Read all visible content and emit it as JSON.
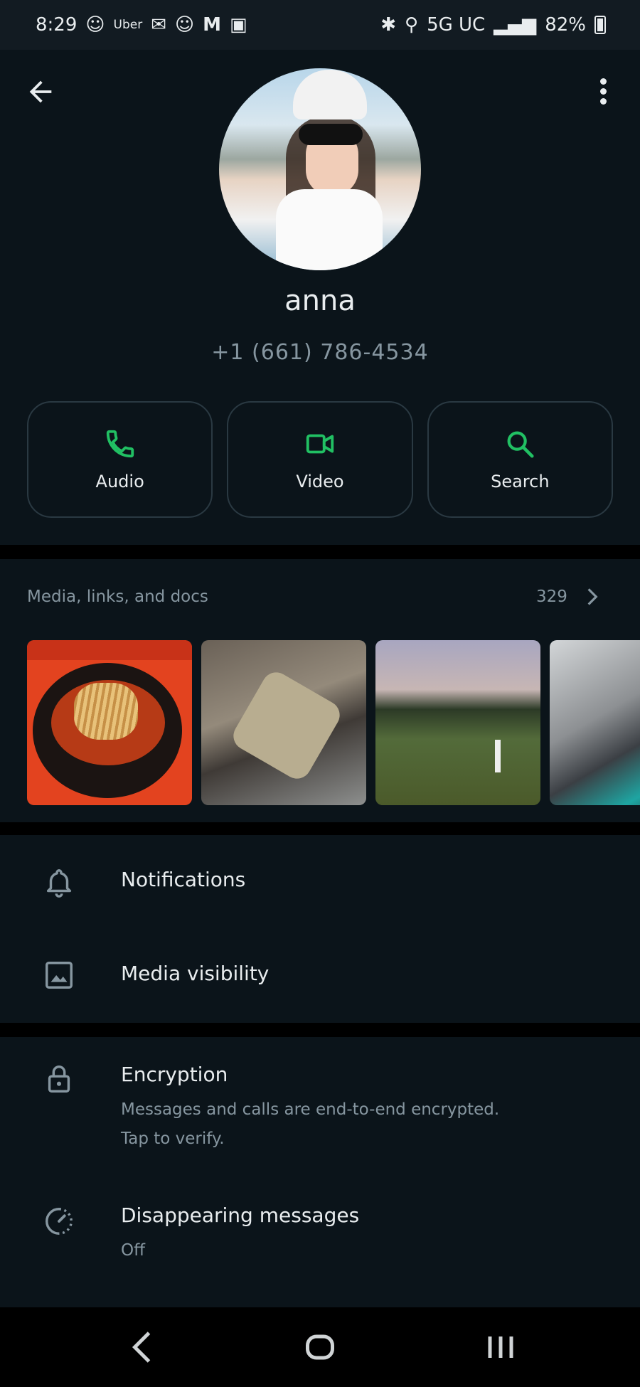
{
  "status_bar": {
    "time": "8:29",
    "uber": "Uber",
    "m_letter": "M",
    "network": "5G UC",
    "battery": "82%"
  },
  "contact": {
    "name": "anna",
    "phone": "+1 (661) 786-4534"
  },
  "actions": [
    {
      "label": "Audio",
      "icon": "phone-icon"
    },
    {
      "label": "Video",
      "icon": "video-icon"
    },
    {
      "label": "Search",
      "icon": "search-icon"
    }
  ],
  "media": {
    "title": "Media, links, and docs",
    "count": "329"
  },
  "settings": {
    "notifications": "Notifications",
    "media_visibility": "Media visibility",
    "encryption_title": "Encryption",
    "encryption_line1": "Messages and calls are end-to-end encrypted.",
    "encryption_line2": "Tap to verify.",
    "disappearing_title": "Disappearing messages",
    "disappearing_value": "Off"
  },
  "colors": {
    "background": "#0b141a",
    "accent": "#21c063",
    "secondary_text": "#8696a0"
  }
}
